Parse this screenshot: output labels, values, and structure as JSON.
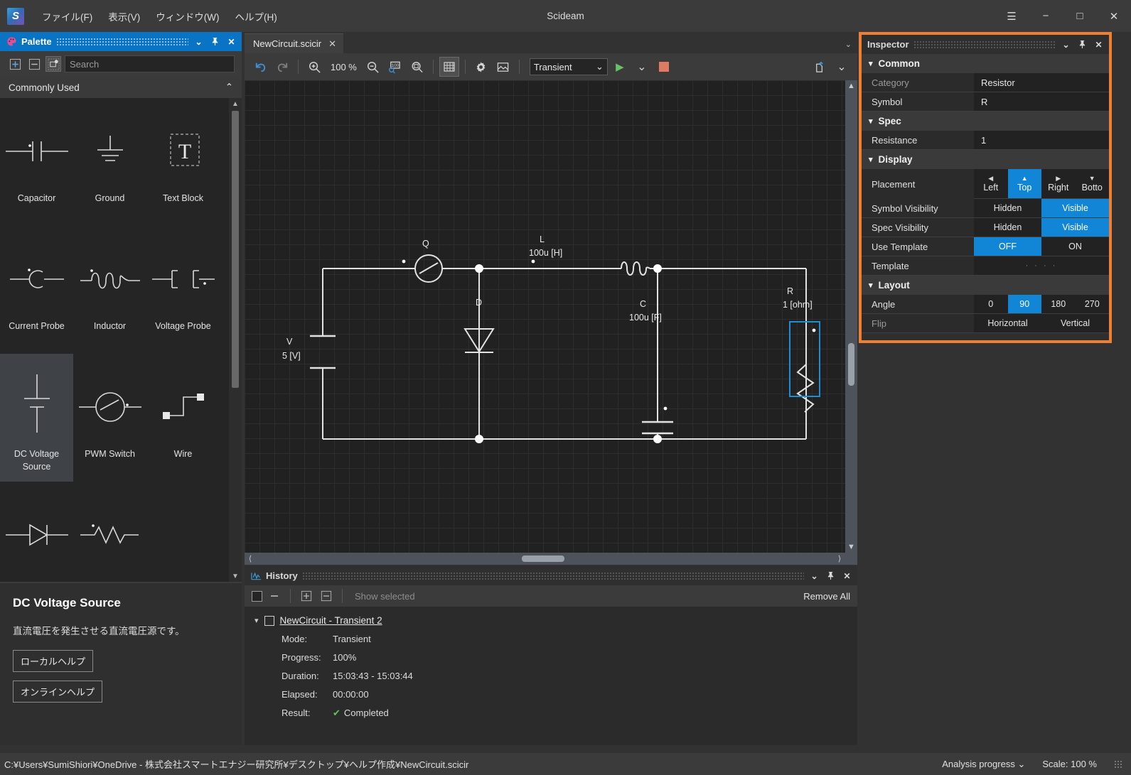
{
  "window": {
    "title": "Scideam",
    "logo_letter": "S",
    "menus": [
      {
        "label": "ファイル(F)",
        "mnemonic": "F"
      },
      {
        "label": "表示(V)",
        "mnemonic": "V"
      },
      {
        "label": "ウィンドウ(W)",
        "mnemonic": "W"
      },
      {
        "label": "ヘルプ(H)",
        "mnemonic": "H"
      }
    ],
    "controls": [
      {
        "name": "hamburger-menu-button",
        "glyph": "☰"
      },
      {
        "name": "minimize-button",
        "glyph": "−"
      },
      {
        "name": "maximize-button",
        "glyph": "□"
      },
      {
        "name": "close-button",
        "glyph": "✕"
      }
    ]
  },
  "palette": {
    "title": "Palette",
    "header_buttons": [
      {
        "name": "panel-chevron-down-icon",
        "glyph": "⌄"
      },
      {
        "name": "panel-pin-icon",
        "glyph": "📌"
      },
      {
        "name": "panel-close-icon",
        "glyph": "✕"
      }
    ],
    "toolbar": {
      "expand_all_label": "expand-all-icon",
      "collapse_all_label": "collapse-all-icon",
      "new_component_label": "new-component-icon"
    },
    "search": {
      "value": "",
      "placeholder": "Search"
    },
    "group": {
      "label": "Commonly Used",
      "collapse_glyph": "⌃"
    },
    "items": [
      {
        "label": "Capacitor",
        "symbol": "capacitor-symbol",
        "selected": false
      },
      {
        "label": "Ground",
        "symbol": "ground-symbol",
        "selected": false
      },
      {
        "label": "Text Block",
        "symbol": "text-block-symbol",
        "selected": false
      },
      {
        "label": "Current Probe",
        "symbol": "current-probe-symbol",
        "selected": false
      },
      {
        "label": "Inductor",
        "symbol": "inductor-symbol",
        "selected": false
      },
      {
        "label": "Voltage Probe",
        "symbol": "voltage-probe-symbol",
        "selected": false
      },
      {
        "label": "DC Voltage Source",
        "symbol": "dc-voltage-source-symbol",
        "selected": true
      },
      {
        "label": "PWM Switch",
        "symbol": "pwm-switch-symbol",
        "selected": false
      },
      {
        "label": "Wire",
        "symbol": "wire-symbol",
        "selected": false
      },
      {
        "label": "",
        "symbol": "diode-symbol",
        "selected": false
      },
      {
        "label": "",
        "symbol": "resistor-symbol",
        "selected": false
      }
    ]
  },
  "description": {
    "title": "DC Voltage Source",
    "text": "直流電圧を発生させる直流電圧源です。",
    "local_help_label": "ローカルヘルプ",
    "online_help_label": "オンラインヘルプ"
  },
  "editor": {
    "tab": {
      "label": "NewCircuit.scicir",
      "close_glyph": "✕"
    },
    "tabbar_overflow_glyph": "⌄",
    "toolbar": {
      "undo_label": "undo-icon",
      "redo_label": "redo-icon",
      "zoom_in_label": "zoom-in-icon",
      "zoom_level": "100 %",
      "zoom_out_label": "zoom-out-icon",
      "zoom_100_label": "zoom-100-icon",
      "zoom_fit_label": "zoom-fit-icon",
      "grid_label": "grid-icon",
      "settings_label": "gear-icon",
      "image_label": "image-icon",
      "mode_value": "Transient",
      "mode_chevron": "⌄",
      "run_label": "run-play-icon",
      "run_menu_chevron": "⌄",
      "stop_label": "stop-icon",
      "export_label": "export-icon",
      "export_chevron": "⌄"
    }
  },
  "circuit": {
    "components": [
      {
        "ref": "Q",
        "value": "",
        "name": "pwm-switch"
      },
      {
        "ref": "L",
        "value": "100u [H]",
        "name": "inductor"
      },
      {
        "ref": "C",
        "value": "100u [F]",
        "name": "capacitor"
      },
      {
        "ref": "R",
        "value": "1 [ohm]",
        "name": "resistor",
        "selected": true
      },
      {
        "ref": "D",
        "value": "",
        "name": "diode"
      },
      {
        "ref": "V",
        "value": "5 [V]",
        "name": "dc-voltage-source"
      }
    ]
  },
  "history": {
    "title": "History",
    "header_buttons": [
      {
        "name": "panel-chevron-down-icon",
        "glyph": "⌄"
      },
      {
        "name": "panel-pin-icon",
        "glyph": "📌"
      },
      {
        "name": "panel-close-icon",
        "glyph": "✕"
      }
    ],
    "toolbar": {
      "stop_label": "stop-square-icon",
      "remove_label": "remove-icon",
      "expand_label": "expand-icon",
      "collapse_label": "collapse-icon",
      "show_selected_label": "Show selected",
      "remove_all_label": "Remove All"
    },
    "entry": {
      "name": "NewCircuit - Transient 2",
      "fields": [
        {
          "key": "Mode:",
          "value": "Transient"
        },
        {
          "key": "Progress:",
          "value": "100%"
        },
        {
          "key": "Duration:",
          "value": "15:03:43  -  15:03:44"
        },
        {
          "key": "Elapsed:",
          "value": "00:00:00"
        }
      ],
      "result_key": "Result:",
      "result_value": "Completed",
      "result_check": "✔"
    }
  },
  "inspector": {
    "title": "Inspector",
    "header_buttons": [
      {
        "name": "panel-chevron-down-icon",
        "glyph": "⌄"
      },
      {
        "name": "panel-pin-icon",
        "glyph": "📌"
      },
      {
        "name": "panel-close-icon",
        "glyph": "✕"
      }
    ],
    "groups": [
      {
        "label": "Common",
        "rows": [
          {
            "key": "Category",
            "type": "text",
            "value": "Resistor",
            "dim": true
          },
          {
            "key": "Symbol",
            "type": "text",
            "value": "R",
            "dim": false
          }
        ]
      },
      {
        "label": "Spec",
        "rows": [
          {
            "key": "Resistance",
            "type": "text",
            "value": "1",
            "dim": false
          }
        ]
      },
      {
        "label": "Display",
        "rows": [
          {
            "key": "Placement",
            "type": "placement",
            "options": [
              {
                "label": "Left",
                "arrow": "◀",
                "on": false
              },
              {
                "label": "Top",
                "arrow": "▲",
                "on": true
              },
              {
                "label": "Right",
                "arrow": "▶",
                "on": false
              },
              {
                "label": "Botto",
                "arrow": "▼",
                "on": false
              }
            ]
          },
          {
            "key": "Symbol Visibility",
            "type": "segment",
            "options": [
              {
                "label": "Hidden",
                "on": false
              },
              {
                "label": "Visible",
                "on": true
              }
            ]
          },
          {
            "key": "Spec Visibility",
            "type": "segment",
            "options": [
              {
                "label": "Hidden",
                "on": false
              },
              {
                "label": "Visible",
                "on": true
              }
            ]
          },
          {
            "key": "Use Template",
            "type": "segment",
            "options": [
              {
                "label": "OFF",
                "on": true
              },
              {
                "label": "ON",
                "on": false
              }
            ]
          },
          {
            "key": "Template",
            "type": "dots",
            "value": "· · · ·"
          }
        ]
      },
      {
        "label": "Layout",
        "rows": [
          {
            "key": "Angle",
            "type": "segment",
            "options": [
              {
                "label": "0",
                "on": false
              },
              {
                "label": "90",
                "on": true
              },
              {
                "label": "180",
                "on": false
              },
              {
                "label": "270",
                "on": false
              }
            ]
          },
          {
            "key": "Flip",
            "type": "segment",
            "dim": true,
            "options": [
              {
                "label": "Horizontal",
                "on": false
              },
              {
                "label": "Vertical",
                "on": false
              }
            ]
          }
        ]
      }
    ]
  },
  "statusbar": {
    "path": "C:¥Users¥SumiShiori¥OneDrive - 株式会社スマートエナジー研究所¥デスクトップ¥ヘルプ作成¥NewCircuit.scicir",
    "analysis_progress_label": "Analysis progress",
    "analysis_chevron": "⌄",
    "scale_label": "Scale:",
    "scale_value": "100 %"
  },
  "colors": {
    "accent_blue": "#1186d6",
    "panel_active": "#0a74c4",
    "highlight_orange": "#ef8033",
    "selection_blue": "#1e8fd6",
    "success_green": "#5ec45e",
    "run_green": "#69c169",
    "stop_red": "#e07a60"
  }
}
